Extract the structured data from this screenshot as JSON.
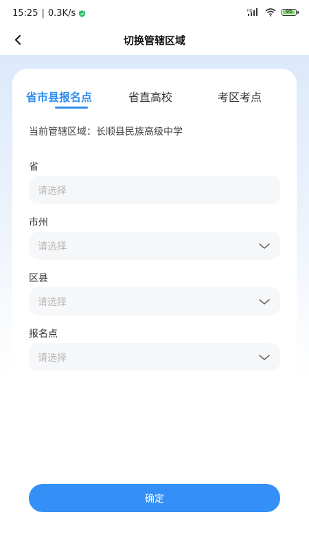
{
  "status_bar": {
    "time": "15:25",
    "separator": "|",
    "speed": "0.3K/s",
    "battery": "95",
    "battery_level_percent": 95
  },
  "nav": {
    "title": "切换管辖区域",
    "back_icon": "chevron-left-icon"
  },
  "tabs": [
    {
      "label": "省市县报名点",
      "active": true
    },
    {
      "label": "省直高校",
      "active": false
    },
    {
      "label": "考区考点",
      "active": false
    }
  ],
  "current_area": "当前管辖区域：长顺县民族高级中学",
  "fields": [
    {
      "label": "省",
      "placeholder": "请选择",
      "has_dropdown": false
    },
    {
      "label": "市州",
      "placeholder": "请选择",
      "has_dropdown": true
    },
    {
      "label": "区县",
      "placeholder": "请选择",
      "has_dropdown": true
    },
    {
      "label": "报名点",
      "placeholder": "请选择",
      "has_dropdown": true
    }
  ],
  "confirm_label": "确定",
  "colors": {
    "accent": "#2f8ef0",
    "button": "#3490f6",
    "field_bg": "#f6f7f9",
    "placeholder": "#b8b8b8"
  }
}
